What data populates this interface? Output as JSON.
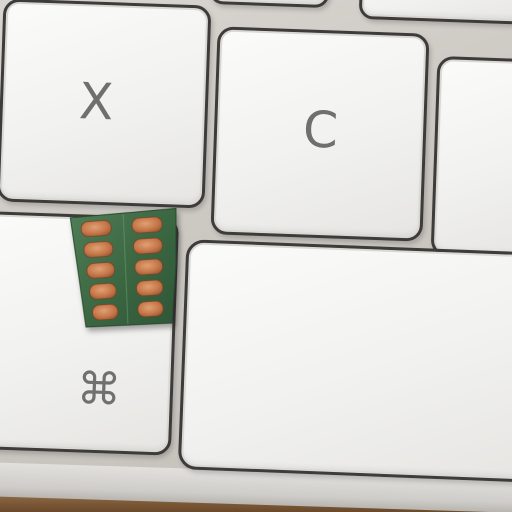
{
  "keyboard": {
    "keys": {
      "x": {
        "legend": "X"
      },
      "c": {
        "legend": "C"
      },
      "command": {
        "legend": "⌘"
      }
    }
  },
  "colors": {
    "keycap": "#f2f2f0",
    "key_border": "#3d3c3a",
    "legend": "#6f6f6f",
    "blister_foil": "#3f6b45",
    "pill": "#c77a4c"
  },
  "objects": {
    "blister_pack": {
      "icon": "pill-blister-icon",
      "pill_count": 10
    }
  }
}
